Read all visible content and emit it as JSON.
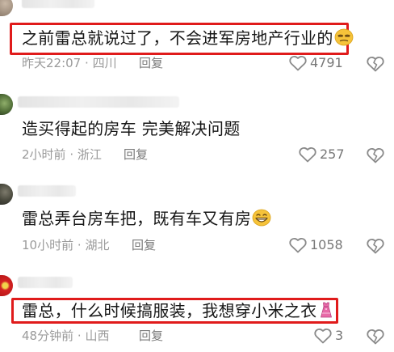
{
  "comments": [
    {
      "avatar": "avatar",
      "content": "之前雷总就说过了，不会进军房地产行业的",
      "emoji": "smirk-face-emoji",
      "time": "昨天22:07",
      "location": "四川",
      "reply_label": "回复",
      "like_count": "4791",
      "highlighted": true
    },
    {
      "avatar": "avatar",
      "content": "造买得起的房车  完美解决问题",
      "emoji": "",
      "time": "2小时前",
      "location": "浙江",
      "reply_label": "回复",
      "like_count": "257",
      "highlighted": false
    },
    {
      "avatar": "avatar",
      "content": "雷总弄台房车把，既有车又有房",
      "emoji": "grinning-face-emoji",
      "time": "10小时前",
      "location": "湖北",
      "reply_label": "回复",
      "like_count": "1058",
      "highlighted": false
    },
    {
      "avatar": "avatar",
      "content": "雷总，什么时候搞服装，我想穿小米之衣",
      "emoji": "dress-emoji",
      "time": "48分钟前",
      "location": "山西",
      "reply_label": "回复",
      "like_count": "3",
      "highlighted": true
    }
  ],
  "separator": "·",
  "colors": {
    "highlight_border": "#e01b1b",
    "meta_text": "#9a9a9a",
    "reply_text": "#7a7a7a",
    "icon": "#8a8a8a"
  }
}
